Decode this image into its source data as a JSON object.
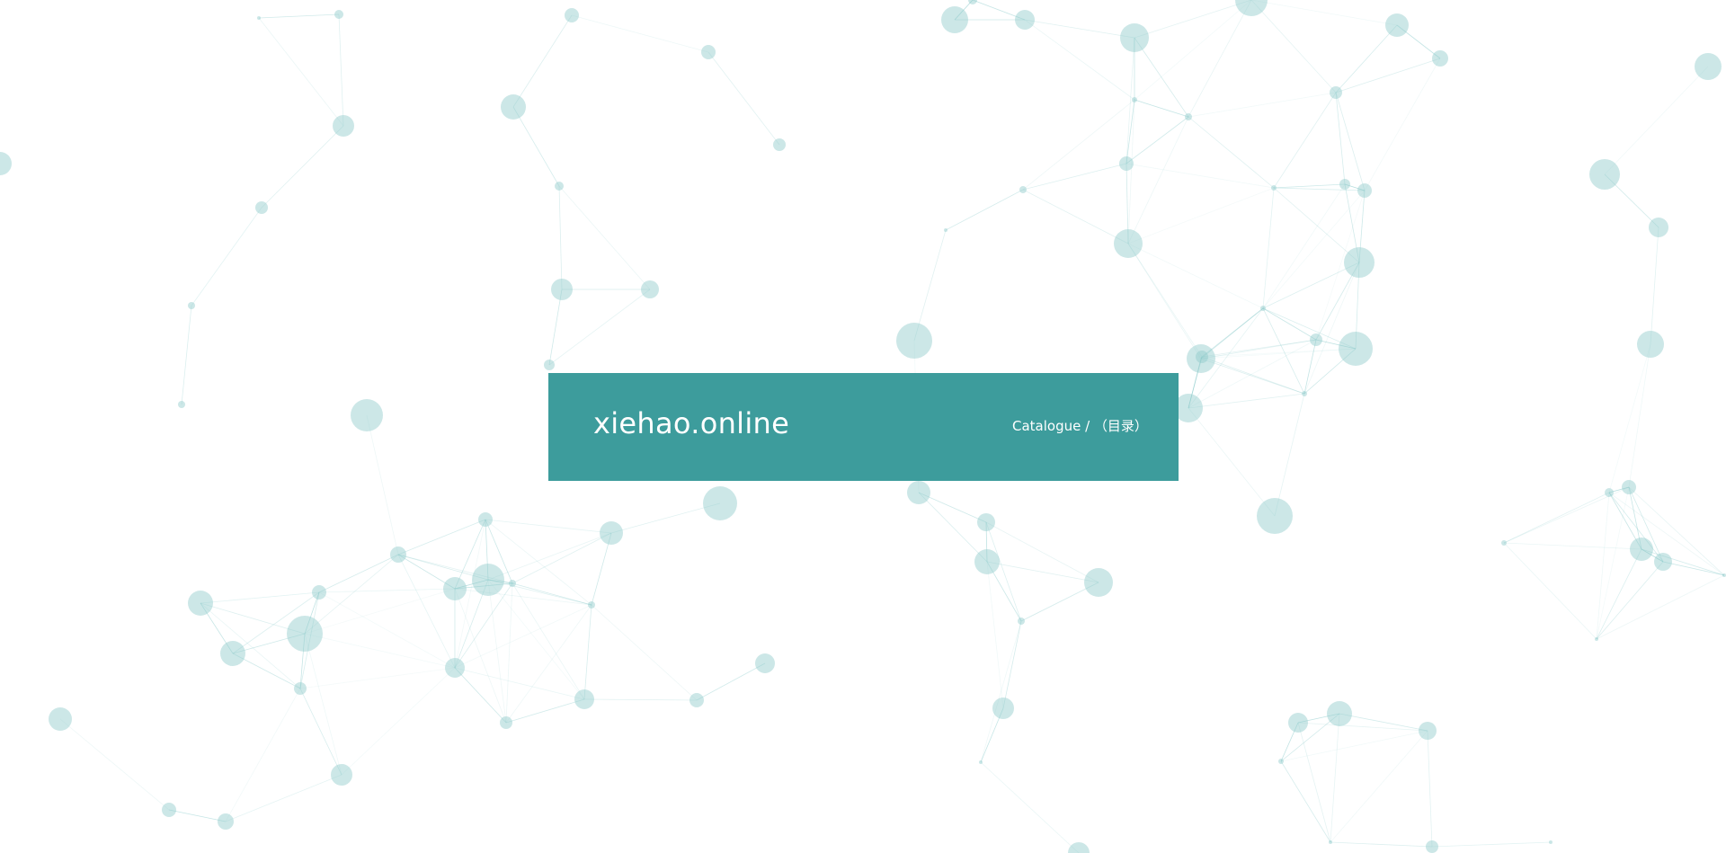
{
  "header": {
    "title": "xiehao.online",
    "nav_link": "Catalogue / （目录）",
    "background_color": "#3d9c9c",
    "text_color": "#ffffff"
  },
  "background": {
    "color": "#ffffff",
    "particle_color": "#8ecaca",
    "line_color": "#7cc4c4"
  }
}
